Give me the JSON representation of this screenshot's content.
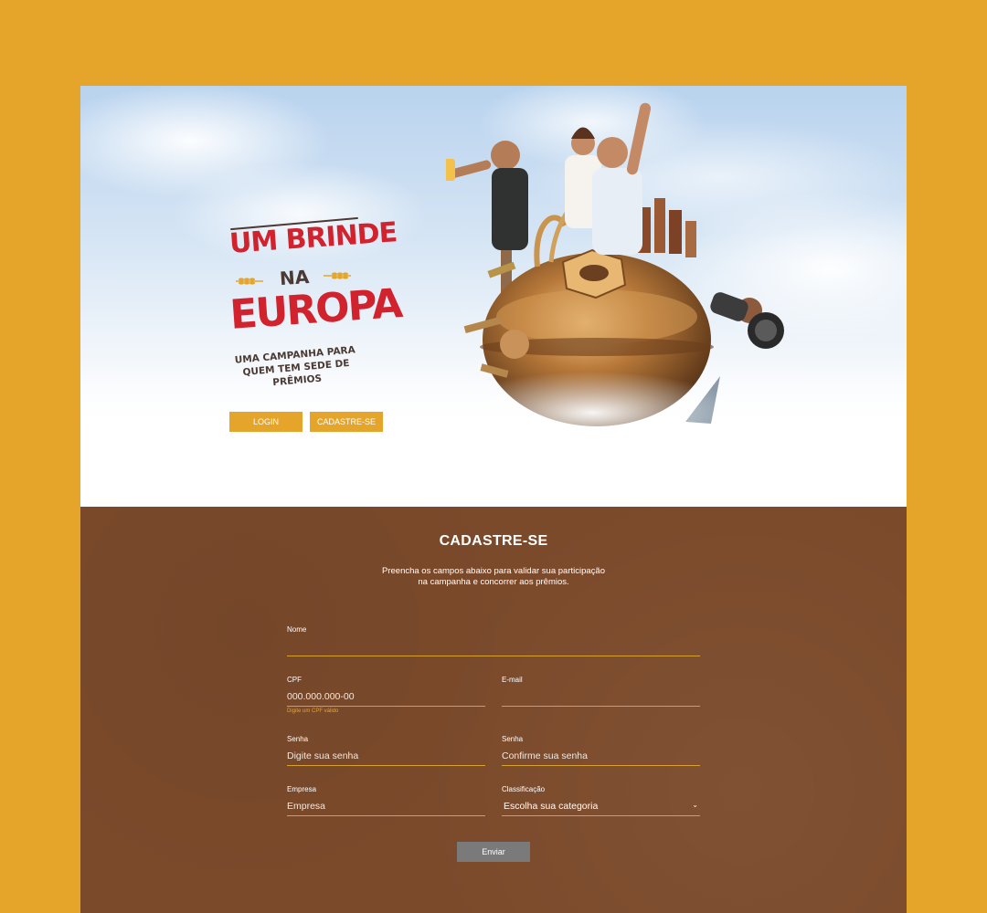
{
  "hero": {
    "logo": {
      "line1": "UM BRINDE",
      "line2": "NA",
      "line3": "EUROPA",
      "tagline_1": "UMA CAMPANHA PARA",
      "tagline_2": "QUEM TEM SEDE DE PRÊMIOS"
    },
    "login_label": "LOGIN",
    "signup_label": "CADASTRE-SE"
  },
  "form": {
    "title": "CADASTRE-SE",
    "description_1": "Preencha os campos abaixo para validar sua participação",
    "description_2": "na campanha e concorrer aos prêmios.",
    "nome": {
      "label": "Nome",
      "placeholder": ""
    },
    "cpf": {
      "label": "CPF",
      "placeholder": "000.000.000-00",
      "hint": "Digite um CPF válido"
    },
    "email": {
      "label": "E-mail",
      "placeholder": ""
    },
    "senha": {
      "label": "Senha",
      "placeholder": "Digite sua senha"
    },
    "confirma_senha": {
      "label": "Senha",
      "placeholder": "Confirme sua senha"
    },
    "empresa": {
      "label": "Empresa",
      "placeholder": "Empresa"
    },
    "classificacao": {
      "label": "Classificação",
      "selected": "Escolha sua categoria"
    },
    "submit_label": "Enviar"
  },
  "colors": {
    "background": "#E5A52B",
    "accent": "#E5A52B",
    "logo_red": "#d1232e",
    "form_bg": "#7b4a2b",
    "submit_bg": "#7a7a7a"
  },
  "icons": {
    "select_chevron": "chevron-down-icon",
    "wheat": "wheat-icon"
  }
}
